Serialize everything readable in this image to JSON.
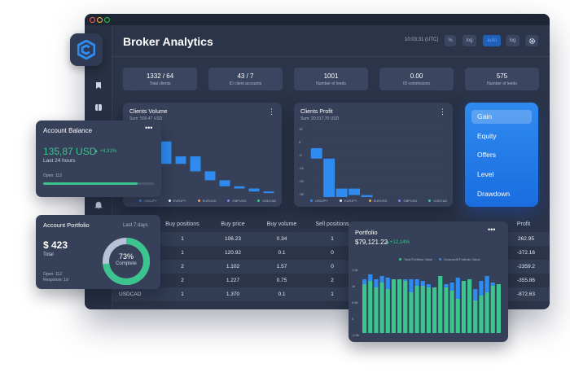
{
  "app": {
    "title": "Broker Analytics",
    "clock": "10:03:31 (UTC)",
    "header_buttons": [
      "%",
      "log",
      "auto",
      "log"
    ]
  },
  "stats": [
    {
      "value": "1332 / 64",
      "label": "Total clients"
    },
    {
      "value": "43 / 7",
      "label": "ID client accounts"
    },
    {
      "value": "1001",
      "label": "Number of leeds"
    },
    {
      "value": "0.00",
      "label": "ID commisions"
    },
    {
      "value": "575",
      "label": "Number of leeds"
    }
  ],
  "clients_volume": {
    "title": "Clients Volume",
    "subtitle": "Sum: 500.47 USD"
  },
  "clients_profit": {
    "title": "Clients Profit",
    "subtitle": "Sum: 20.017.70 USD"
  },
  "legend": [
    "USDJPY",
    "EURJPY",
    "EURUSD",
    "GBPUSD",
    "USDCAD"
  ],
  "legend_colors": [
    "#2f8bf0",
    "#e6ecf7",
    "#f2a541",
    "#7b83ff",
    "#3bc48d"
  ],
  "side_menu": {
    "items": [
      "Gain",
      "Equity",
      "Offers",
      "Level",
      "Drawdown"
    ],
    "active": "Gain"
  },
  "account_balance": {
    "title": "Account Balance",
    "value": "135,87 USD",
    "change": "+4,31%",
    "period": "Last 24 hours",
    "open": "Open: 112",
    "progress": 0.85
  },
  "account_portfolio": {
    "title": "Account Portfolio",
    "period": "Last 7 days",
    "value": "$ 423",
    "value_label": "Total",
    "open": "Open: 112",
    "response": "Response: 1d",
    "donut_percent": "73%",
    "donut_label": "Complete",
    "donut_fraction": 0.73
  },
  "table": {
    "headers": [
      "Buy positions",
      "Buy price",
      "Buy volume",
      "Sell positions",
      "Profit"
    ],
    "rows": [
      {
        "symbol": "",
        "buy_positions": "1",
        "buy_price": "106.23",
        "buy_volume": "0.34",
        "sell_positions": "1",
        "profit": "262.95"
      },
      {
        "symbol": "",
        "buy_positions": "1",
        "buy_price": "120.92",
        "buy_volume": "0.1",
        "sell_positions": "0",
        "profit": "-372.16"
      },
      {
        "symbol": "",
        "buy_positions": "2",
        "buy_price": "1.102",
        "buy_volume": "1.57",
        "sell_positions": "0",
        "profit": "-2359.2"
      },
      {
        "symbol": "",
        "buy_positions": "2",
        "buy_price": "1.227",
        "buy_volume": "0.75",
        "sell_positions": "2",
        "profit": "-355.86"
      },
      {
        "symbol": "USDCAD",
        "buy_positions": "1",
        "buy_price": "1.370",
        "buy_volume": "0.1",
        "sell_positions": "1",
        "profit": "-872.63"
      }
    ]
  },
  "portfolio": {
    "title": "Portfolio",
    "value": "$79,121.22",
    "change": "+12,14%",
    "legend": [
      "Total Portfolio Value",
      "Downshift Portfolio Value"
    ]
  },
  "chart_data": [
    {
      "type": "bar",
      "title": "Clients Volume",
      "subtitle": "Sum: 500.47 USD",
      "note": "waterfall-style bars, partially hidden",
      "values": [
        40,
        -15,
        -30,
        10,
        -20,
        -12,
        -8,
        -3,
        -4,
        -2
      ],
      "color": "#2f8bf0"
    },
    {
      "type": "bar",
      "title": "Clients Profit",
      "subtitle": "Sum: 20.017.70 USD",
      "y_ticks": [
        "15",
        "5",
        "-5",
        "-15",
        "-25",
        "-35"
      ],
      "values": [
        -8,
        -35,
        12,
        -5,
        -6,
        -3,
        -1,
        -2,
        -3,
        -1,
        -2
      ],
      "color": "#2f8bf0"
    },
    {
      "type": "bar",
      "title": "Portfolio",
      "y_ticks": [
        "1.5k",
        "1k",
        "0.5k",
        "0",
        "-0.5k"
      ],
      "series": [
        {
          "name": "Total Portfolio Value",
          "values": [
            1.05,
            1.15,
            0.95,
            1.1,
            0.9,
            1.2,
            1.2,
            1.15,
            0.8,
            1.0,
            1.0,
            0.95,
            0.95,
            1.3,
            0.95,
            0.85,
            0.6,
            1.15,
            1.2,
            0.55,
            0.7,
            0.8,
            1.0,
            1.05
          ],
          "color": "#3bc48d"
        },
        {
          "name": "Downshift Portfolio Value",
          "values": [
            1.2,
            1.35,
            1.2,
            1.3,
            1.25,
            1.05,
            1.1,
            1.2,
            1.2,
            1.2,
            1.15,
            1.05,
            0.95,
            1.15,
            1.05,
            1.1,
            1.25,
            1.0,
            1.05,
            0.9,
            1.15,
            1.3,
            1.1,
            1.05
          ],
          "color": "#2f8bf0"
        }
      ],
      "ylim": [
        -0.5,
        1.5
      ]
    }
  ]
}
